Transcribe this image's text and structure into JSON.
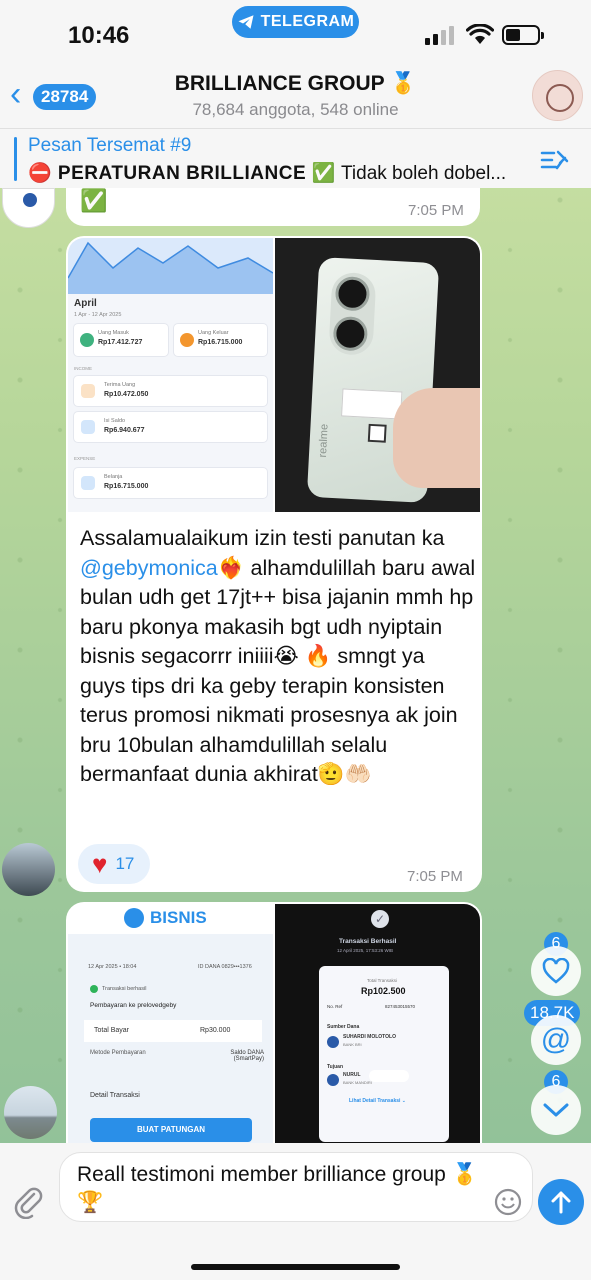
{
  "status_bar": {
    "time": "10:46",
    "pill": "TELEGRAM"
  },
  "header": {
    "back_count": "28784",
    "title": "BRILLIANCE GROUP 🥇",
    "subtitle": "78,684 anggota, 548 online"
  },
  "pinned": {
    "title": "Pesan Tersemat #9",
    "text_bold": "⛔ PERATURAN BRILLIANCE ✅",
    "text_rest": " Tidak boleh dobel..."
  },
  "messages": [
    {
      "partial_emoji": "✅",
      "time": "7:05 PM"
    },
    {
      "text_before": "Assalamualaikum izin testi panutan ka ",
      "mention": "@gebymonica",
      "text_after": "❤️‍🔥 alhamdulillah baru awal bulan udh get 17jt++ bisa jajanin mmh hp baru pkonya makasih bgt udh nyiptain bisnis segacorrr iniiii😭 🔥 smngt ya guys tips dri ka geby terapin konsisten terus promosi nikmati prosesnya ak join bru 10bulan alhamdulillah selalu bermanfaat dunia akhirat🫡🤲🏻",
      "reaction_count": "17",
      "time": "7:05 PM"
    }
  ],
  "screenshot_left": {
    "month": "April",
    "range": "1 Apr - 12 Apr 2025",
    "in_label": "Uang Masuk",
    "in_value": "Rp17.412.727",
    "out_label": "Uang Keluar",
    "out_value": "Rp16.715.000",
    "income": "INCOME",
    "recv_label": "Terima Uang",
    "recv_value": "Rp10.472.050",
    "topup_label": "Isi Saldo",
    "topup_value": "Rp6.940.677",
    "expense": "EXPENSE",
    "shop_label": "Belanja",
    "shop_value": "Rp16.715.000"
  },
  "screenshot_phone": {
    "brand": "realme"
  },
  "screenshot_bisnis": {
    "logo": "BISNIS",
    "date": "12 Apr 2025 • 18:04",
    "id": "ID DANA 0829•••1376",
    "status": "Transaksi berhasil",
    "desc": "Pembayaran ke prelovedgeby",
    "total_label": "Total Bayar",
    "total_value": "Rp30.000",
    "method_label": "Metode Pembayaran",
    "method_value": "Saldo DANA (SmartPay)",
    "detail": "Detail Transaksi",
    "button": "BUAT PATUNGAN"
  },
  "screenshot_transfer": {
    "status": "Transaksi Berhasil",
    "date": "12 April 2025, 17:53:26 WIB",
    "total_label": "Total Transaksi",
    "total_value": "Rp102.500",
    "ref_label": "No. Ref",
    "ref_value": "827453015570",
    "source_label": "Sumber Dana",
    "source_name": "SUHARDI MOLOTOLO",
    "source_bank": "BANK BRI",
    "dest_label": "Tujuan",
    "dest_name": "NURUL",
    "dest_bank": "BANK MANDIRI",
    "link": "Lihat Detail Transaksi ⌄"
  },
  "side_buttons": {
    "reactions_count": "6",
    "mentions_count": "18.7K",
    "down_count": "6"
  },
  "composer": {
    "text": "Reall testimoni member brilliance group 🥇🏆"
  },
  "colors": {
    "accent": "#2a8fe8",
    "bubble": "#ffffff",
    "reaction_bg": "#e7f1fc"
  }
}
